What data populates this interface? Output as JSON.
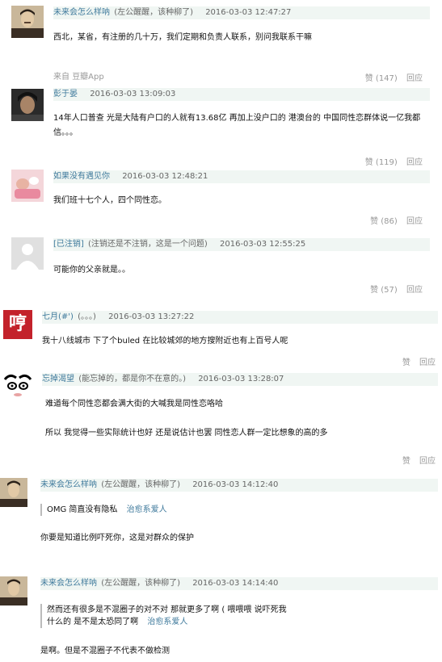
{
  "comments": [
    {
      "author": "未来会怎么样呐",
      "signature": "(左公醒醒，该种柳了)",
      "time": "2016-03-03 12:47:27",
      "text": "西北，某省，有注册的几十万，我们定期和负责人联系，别问我联系干嘛",
      "source_prefix": "来自",
      "source_app": "豆瓣App",
      "likes": "赞 (147)",
      "reply": "回应"
    },
    {
      "author": "彭于晏",
      "time": "2016-03-03 13:09:03",
      "text": "14年人口普查 光是大陆有户口的人就有13.68亿 再加上没户口的 港澳台的 中国同性恋群体说一亿我都信。。。",
      "likes": "赞 (119)",
      "reply": "回应"
    },
    {
      "author": "如果没有遇见你",
      "time": "2016-03-03 12:48:21",
      "text": "我们班十七个人，四个同性恋。",
      "likes": "赞 (86)",
      "reply": "回应"
    },
    {
      "author": "[已注销]",
      "signature": "(注销还是不注销，这是一个问题)",
      "time": "2016-03-03 12:55:25",
      "text": "可能你的父亲就是。。",
      "likes": "赞 (57)",
      "reply": "回应"
    },
    {
      "author": "七月(#')",
      "signature": "(。。。)",
      "time": "2016-03-03 13:27:22",
      "text": "我十八线城市 下了个buled 在比较城郊的地方搜附近也有上百号人呢",
      "likes": "赞",
      "reply": "回应",
      "avatar_char": "哼"
    },
    {
      "author": "忘掉渴望",
      "signature": "(能忘掉的，都是你不在意的。)",
      "time": "2016-03-03 13:28:07",
      "text1": "难道每个同性恋都会满大街的大喊我是同性恋咯哈",
      "text2": "所以 我觉得一些实际统计也好 还是说估计也罢 同性恋人群一定比想象的高的多",
      "likes": "赞",
      "reply": "回应"
    },
    {
      "author": "未来会怎么样呐",
      "signature": "(左公醒醒，该种柳了)",
      "time": "2016-03-03 14:12:40",
      "quote_text": "OMG 简直没有隐私",
      "quote_author": "治愈系爱人",
      "text": "你要是知道比例吓死你，这是对群众的保护"
    },
    {
      "author": "未来会怎么样呐",
      "signature": "(左公醒醒，该种柳了)",
      "time": "2016-03-03 14:14:40",
      "quote_line1": "然而还有很多是不混圈子的对不对 那就更多了啊 ( 喂喂喂 说吓死我",
      "quote_line2": "什么的 是不是太恐同了啊",
      "quote_author": "治愈系爱人",
      "text": "是啊。但是不混圈子不代表不做检测"
    }
  ]
}
